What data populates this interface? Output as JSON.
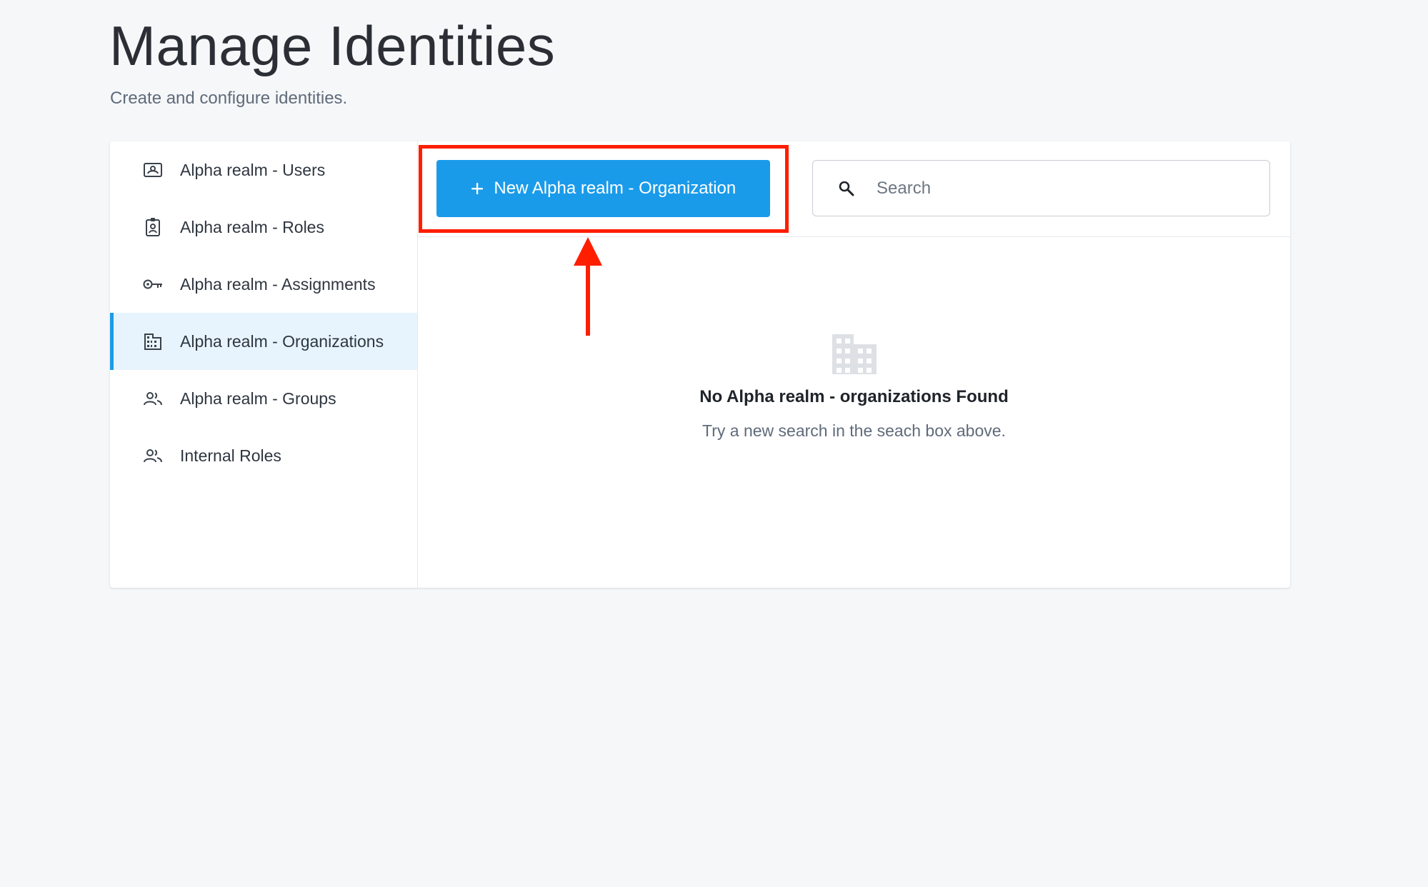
{
  "header": {
    "title": "Manage Identities",
    "subtitle": "Create and configure identities."
  },
  "sidebar": {
    "items": [
      {
        "label": "Alpha realm - Users",
        "icon": "user-card-icon",
        "active": false
      },
      {
        "label": "Alpha realm - Roles",
        "icon": "badge-icon",
        "active": false
      },
      {
        "label": "Alpha realm - Assignments",
        "icon": "key-icon",
        "active": false
      },
      {
        "label": "Alpha realm - Organizations",
        "icon": "building-icon",
        "active": true
      },
      {
        "label": "Alpha realm - Groups",
        "icon": "people-icon",
        "active": false
      },
      {
        "label": "Internal Roles",
        "icon": "people-icon",
        "active": false
      }
    ]
  },
  "toolbar": {
    "new_button_label": "New Alpha realm - Organization",
    "new_button_icon": "plus-icon",
    "search_placeholder": "Search",
    "search_value": ""
  },
  "empty_state": {
    "icon": "building-icon",
    "title": "No Alpha realm - organizations Found",
    "message": "Try a new search in the seach box above."
  },
  "annotation": {
    "highlight_color": "#ff1e00"
  },
  "colors": {
    "accent": "#1a9bea",
    "active_bg": "#e7f4fd",
    "page_bg": "#f6f7f9"
  }
}
